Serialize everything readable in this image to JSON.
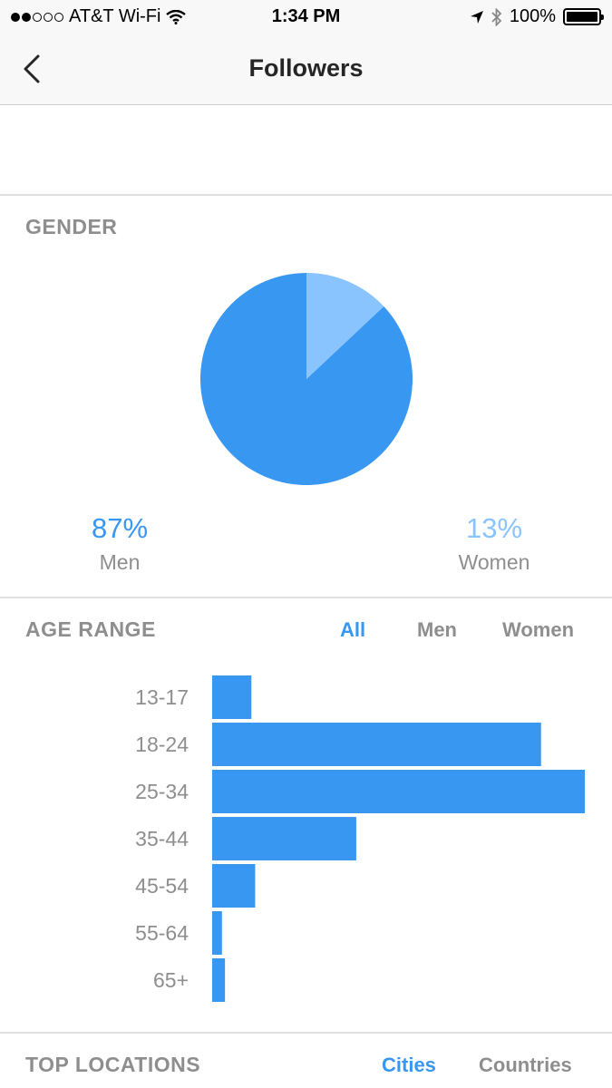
{
  "status_bar": {
    "carrier": "AT&T Wi-Fi",
    "time": "1:34 PM",
    "battery": "100%",
    "signal_bars": 2,
    "signal_total": 5
  },
  "nav": {
    "title": "Followers",
    "back_icon": "chevron-left-icon"
  },
  "gender": {
    "title": "GENDER",
    "men_pct": "87%",
    "men_label": "Men",
    "women_pct": "13%",
    "women_label": "Women",
    "colors": {
      "men": "#3897f0",
      "women": "#89c4ff"
    }
  },
  "age_range": {
    "title": "AGE RANGE",
    "tabs": [
      {
        "label": "All",
        "active": true
      },
      {
        "label": "Men",
        "active": false
      },
      {
        "label": "Women",
        "active": false
      }
    ]
  },
  "top_locations": {
    "title": "TOP LOCATIONS",
    "tabs": [
      {
        "label": "Cities",
        "active": true
      },
      {
        "label": "Countries",
        "active": false
      }
    ]
  },
  "chart_data": [
    {
      "type": "pie",
      "categories": [
        "Men",
        "Women"
      ],
      "values": [
        87,
        13
      ],
      "colors": [
        "#3897f0",
        "#89c4ff"
      ]
    },
    {
      "type": "bar",
      "orientation": "horizontal",
      "categories": [
        "13-17",
        "18-24",
        "25-34",
        "35-44",
        "45-54",
        "55-64",
        "65+"
      ],
      "values": [
        10.4,
        87.2,
        98.8,
        38.2,
        11.4,
        2.6,
        3.4
      ],
      "xlim": [
        0,
        100
      ],
      "color": "#3897f0"
    }
  ]
}
